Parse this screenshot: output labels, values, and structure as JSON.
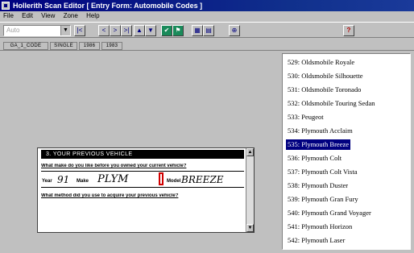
{
  "title_bar": {
    "title": "Hollerith Scan Editor [ Entry Form: Automobile Codes ]"
  },
  "menu": [
    "File",
    "Edit",
    "View",
    "Zone",
    "Help"
  ],
  "toolbar": {
    "combo_value": "Auto",
    "buttons": [
      {
        "name": "first",
        "label": "|<"
      },
      {
        "name": "prev",
        "label": "<"
      },
      {
        "name": "next",
        "label": ">"
      },
      {
        "name": "last",
        "label": ">|"
      },
      {
        "name": "up",
        "label": "▲"
      },
      {
        "name": "down",
        "label": "▼"
      },
      {
        "name": "accept",
        "label": "✔"
      },
      {
        "name": "flag",
        "label": "⚑"
      },
      {
        "name": "view-a",
        "label": "▦"
      },
      {
        "name": "view-b",
        "label": "▤"
      },
      {
        "name": "zoom",
        "label": "⊕"
      },
      {
        "name": "help",
        "label": "?"
      }
    ]
  },
  "field_tabs": [
    "GA_1_CODE",
    "SINGLE",
    "1986",
    "1983"
  ],
  "snippet": {
    "header": "3. YOUR PREVIOUS VEHICLE",
    "question1": "What make do you like before you owned your current vehicle?",
    "year_label": "Year",
    "year_value": "91",
    "make_label": "Make",
    "make_value": "PLYM",
    "model_label": "Model",
    "model_value": "BREEZE",
    "question2": "What method did you use to acquire your previous vehicle?"
  },
  "list": {
    "selected_index": 6,
    "items": [
      "529: Oldsmobile Royale",
      "530: Oldsmobile Silhouette",
      "531: Oldsmobile Toronado",
      "532: Oldsmobile Touring Sedan",
      "533: Peugeot",
      "534: Plymouth Acclaim",
      "535: Plymouth Breeze",
      "536: Plymouth Colt",
      "537: Plymouth Colt Vista",
      "538: Plymouth Duster",
      "539: Plymouth Gran Fury",
      "540: Plymouth Grand Voyager",
      "541: Plymouth Horizon",
      "542: Plymouth Laser"
    ]
  },
  "colors": {
    "titlebar": "#000080",
    "selection": "#000080",
    "toolbar_green": "#1a8a5a",
    "highlight_box": "#d00000"
  }
}
